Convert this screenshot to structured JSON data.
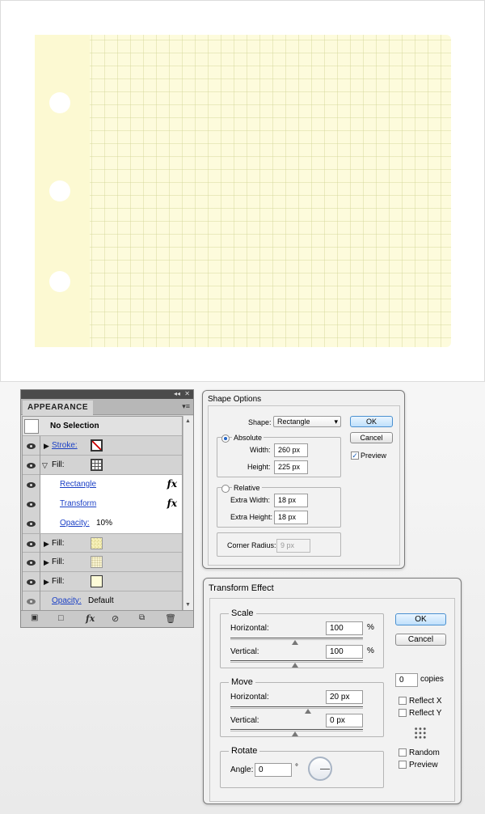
{
  "appearance_panel": {
    "header_arrows": "◂◂",
    "close": "✕",
    "tab_label": "APPEARANCE",
    "menu_icon": "▾≡",
    "title_row": "No Selection",
    "rows": [
      {
        "label": "Stroke:",
        "type": "stroke"
      },
      {
        "label": "Fill:",
        "type": "fill-grid"
      },
      {
        "label": "Rectangle",
        "type": "effect"
      },
      {
        "label": "Transform",
        "type": "effect"
      },
      {
        "label": "Opacity:",
        "value": "10%",
        "type": "opacity"
      },
      {
        "label": "Fill:",
        "type": "fill-pattern"
      },
      {
        "label": "Fill:",
        "type": "fill-dots"
      },
      {
        "label": "Fill:",
        "type": "fill-plain"
      },
      {
        "label": "Opacity:",
        "value": "Default",
        "type": "opacity-default"
      }
    ],
    "fx_symbol": "fx",
    "scroll_up": "▲",
    "scroll_down": "▼",
    "colors": {
      "link": "#1a3fc5",
      "panel": "#d6d6d6"
    }
  },
  "shape_options": {
    "title": "Shape Options",
    "shape_label": "Shape:",
    "shape_value": "Rectangle",
    "dropdown_arrow": "▾",
    "absolute_label": "Absolute",
    "width_label": "Width:",
    "width_value": "260 px",
    "height_label": "Height:",
    "height_value": "225 px",
    "relative_label": "Relative",
    "extra_width_label": "Extra Width:",
    "extra_width_value": "18 px",
    "extra_height_label": "Extra Height:",
    "extra_height_value": "18 px",
    "corner_radius_label": "Corner Radius:",
    "corner_radius_value": "9 px",
    "ok": "OK",
    "cancel": "Cancel",
    "preview_label": "Preview",
    "preview_checked": true,
    "check_mark": "✓"
  },
  "transform_effect": {
    "title": "Transform Effect",
    "scale_label": "Scale",
    "scale_horizontal_label": "Horizontal:",
    "scale_horizontal_value": "100",
    "scale_vertical_label": "Vertical:",
    "scale_vertical_value": "100",
    "percent": "%",
    "move_label": "Move",
    "move_horizontal_label": "Horizontal:",
    "move_horizontal_value": "20 px",
    "move_vertical_label": "Vertical:",
    "move_vertical_value": "0 px",
    "rotate_label": "Rotate",
    "angle_label": "Angle:",
    "angle_value": "0",
    "degree": "°",
    "ok": "OK",
    "cancel": "Cancel",
    "copies_value": "0",
    "copies_label": "copies",
    "reflect_x": "Reflect X",
    "reflect_y": "Reflect Y",
    "random": "Random",
    "preview": "Preview"
  }
}
